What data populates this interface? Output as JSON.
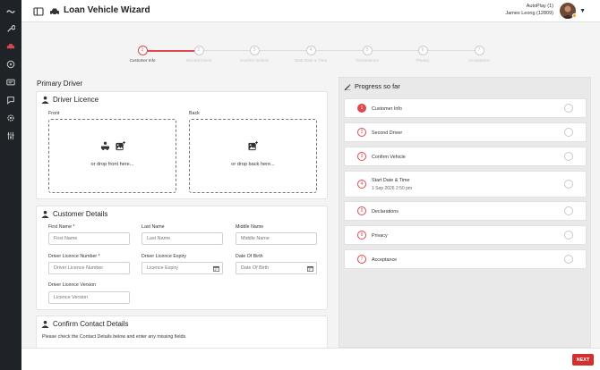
{
  "header": {
    "title": "Loan Vehicle Wizard",
    "store": "AutoPlay (1)",
    "user": "James Leong (12809)"
  },
  "stepper": {
    "steps": [
      {
        "num": "1",
        "label": "Customer Info"
      },
      {
        "num": "2",
        "label": "Second Driver"
      },
      {
        "num": "3",
        "label": "Confirm Vehicle"
      },
      {
        "num": "4",
        "label": "Start Date & Time"
      },
      {
        "num": "5",
        "label": "Declarations"
      },
      {
        "num": "6",
        "label": "Privacy"
      },
      {
        "num": "7",
        "label": "Acceptance"
      }
    ]
  },
  "main": {
    "section_title": "Primary Driver",
    "licence": {
      "title": "Driver Licence",
      "front_label": "Front",
      "back_label": "Back",
      "front_drop": "or drop front here...",
      "back_drop": "or drop back here..."
    },
    "customer": {
      "title": "Customer Details",
      "first_name_label": "First Name *",
      "first_name_placeholder": "First Name",
      "last_name_label": "Last Name",
      "last_name_placeholder": "Last Name",
      "middle_name_label": "Middle Name",
      "middle_name_placeholder": "Middle Name",
      "licence_number_label": "Driver Licence Number *",
      "licence_number_placeholder": "Driver Licence Number",
      "licence_expiry_label": "Driver Licence Expiry",
      "licence_expiry_placeholder": "Licence Expiry",
      "dob_label": "Date Of Birth",
      "dob_placeholder": "Date Of Birth",
      "licence_version_label": "Driver Licence Version",
      "licence_version_placeholder": "Licence Version"
    },
    "contact": {
      "title": "Confirm Contact Details",
      "description": "Please check the Contact Details below and enter any missing fields."
    }
  },
  "progress": {
    "title": "Progress so far",
    "items": [
      {
        "num": "1",
        "label": "Customer Info",
        "sub": ""
      },
      {
        "num": "2",
        "label": "Second Driver",
        "sub": ""
      },
      {
        "num": "3",
        "label": "Confirm Vehicle",
        "sub": ""
      },
      {
        "num": "4",
        "label": "Start Date & Time",
        "sub": "1 Sep 2026 2:50 pm"
      },
      {
        "num": "5",
        "label": "Declarations",
        "sub": ""
      },
      {
        "num": "6",
        "label": "Privacy",
        "sub": ""
      },
      {
        "num": "7",
        "label": "Acceptance",
        "sub": ""
      }
    ]
  },
  "footer": {
    "next_label": "NEXT"
  },
  "colors": {
    "accent": "#e0474c",
    "rail": "#1f2227",
    "next_button": "#d32f2f"
  },
  "icons": [
    "logo-icon",
    "wrench-icon",
    "car-icon",
    "play-circle-icon",
    "id-card-icon",
    "chat-icon",
    "gear-icon",
    "sliders-icon",
    "sidebar-toggle-icon",
    "car-header-icon",
    "driver-icon",
    "car-small-icon",
    "image-add-icon",
    "pen-icon",
    "calendar-icon"
  ]
}
